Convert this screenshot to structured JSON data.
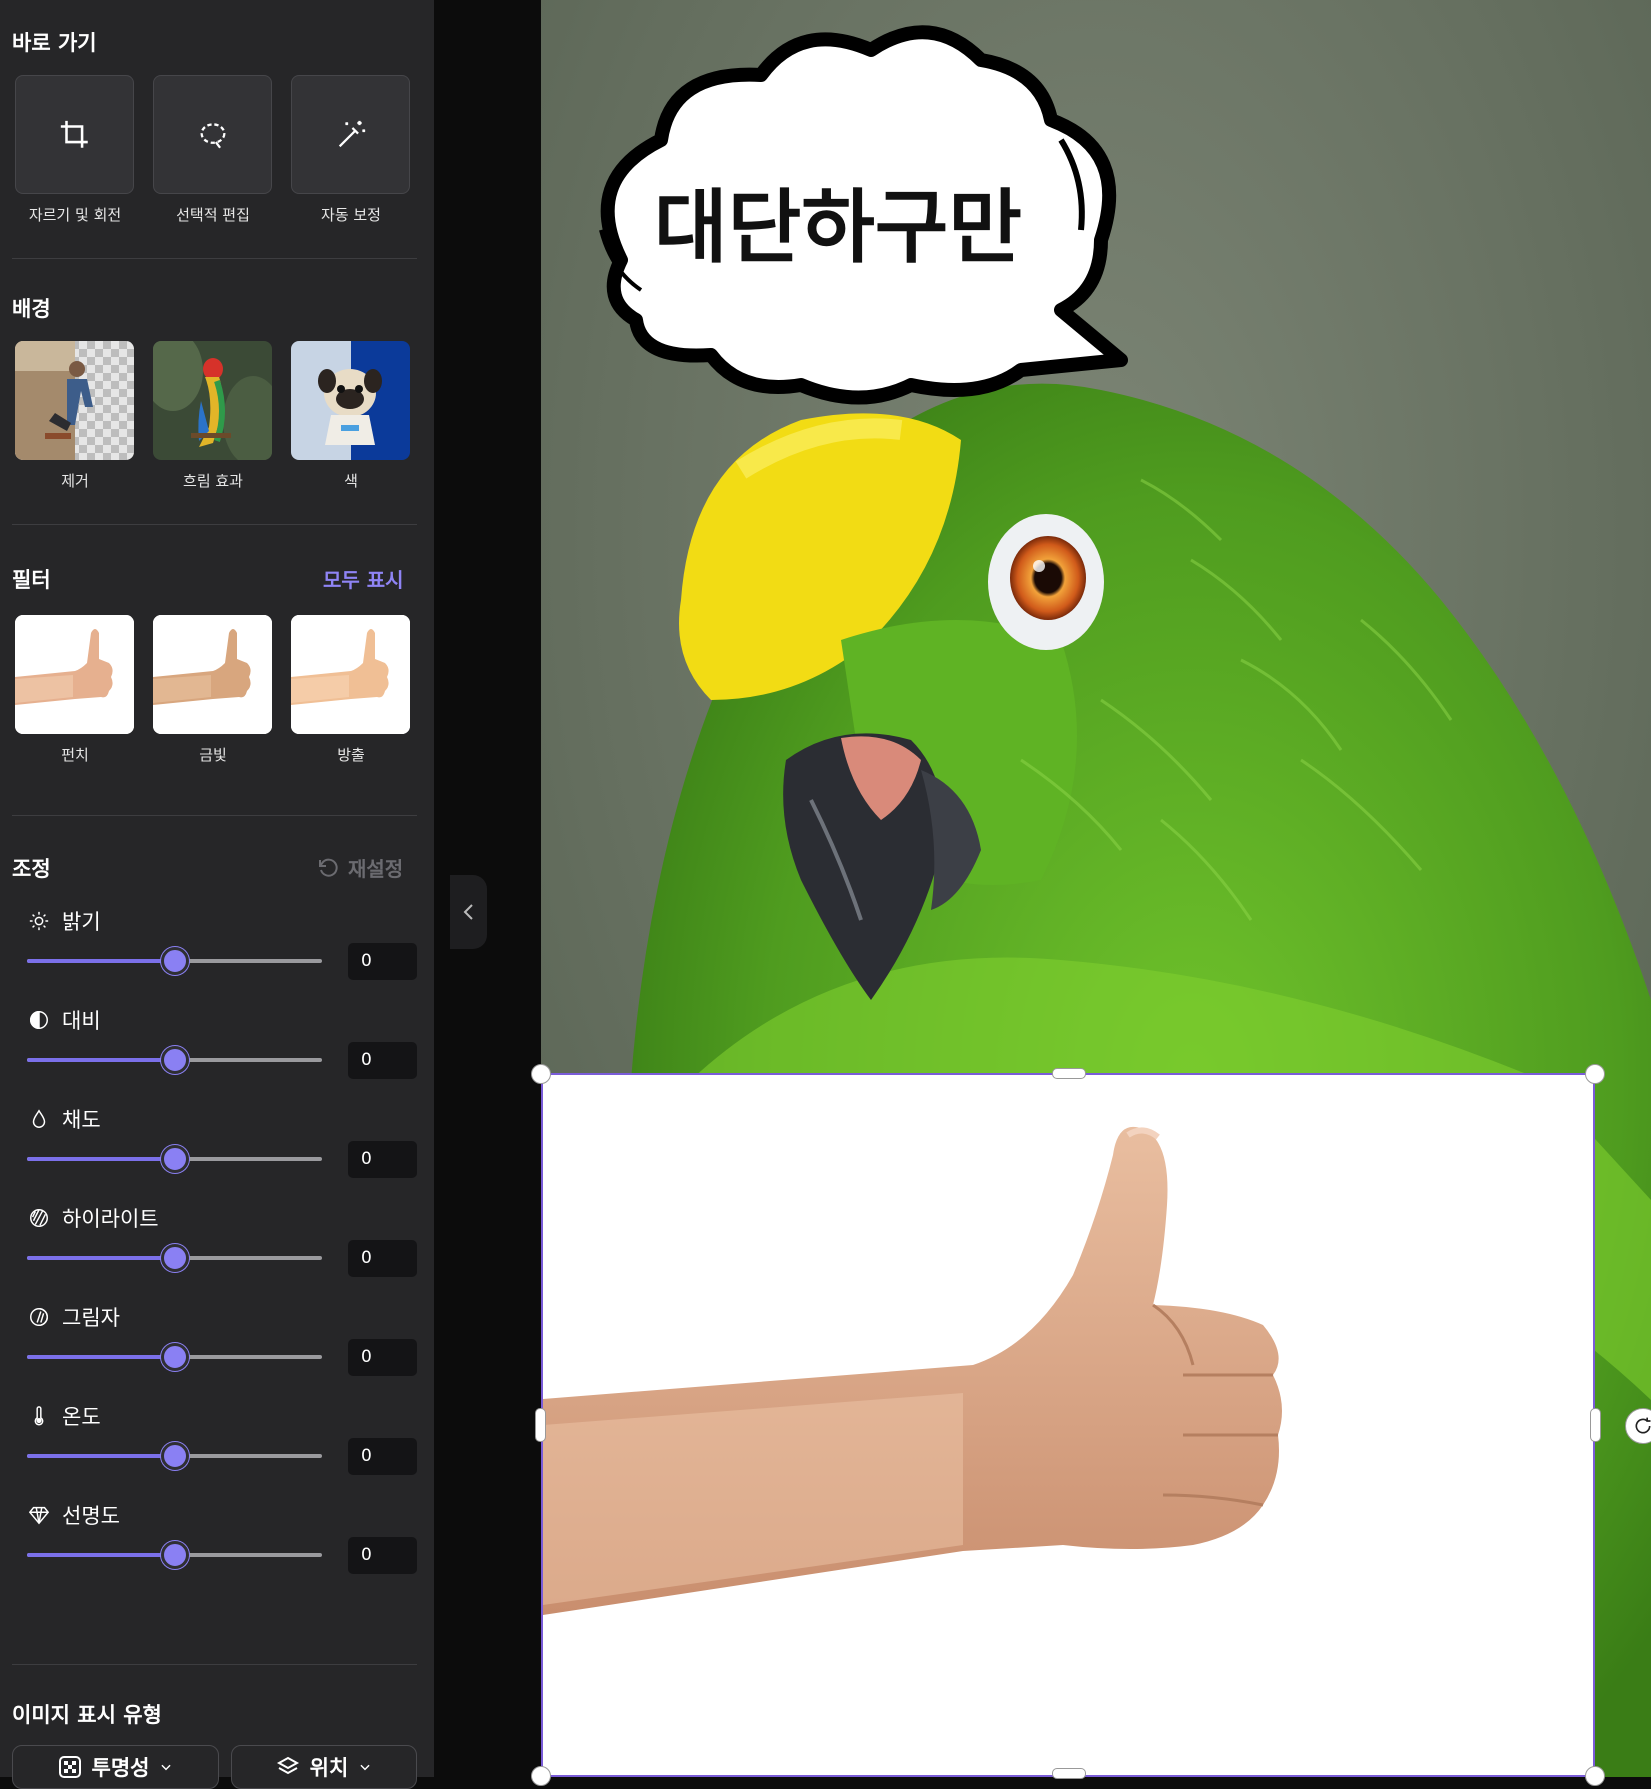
{
  "sidebar": {
    "quick_access": {
      "title": "바로 가기",
      "tools": [
        {
          "label": "자르기 및 회전",
          "icon": "crop-icon"
        },
        {
          "label": "선택적 편집",
          "icon": "lasso-select-icon"
        },
        {
          "label": "자동 보정",
          "icon": "magic-wand-icon"
        }
      ]
    },
    "background": {
      "title": "배경",
      "options": [
        {
          "label": "제거",
          "icon": "remove-background-thumbnail"
        },
        {
          "label": "흐림 효과",
          "icon": "blur-background-thumbnail"
        },
        {
          "label": "색",
          "icon": "color-background-thumbnail"
        }
      ]
    },
    "filters": {
      "title": "필터",
      "show_all": "모두 표시",
      "items": [
        {
          "label": "펀치"
        },
        {
          "label": "금빛"
        },
        {
          "label": "방출"
        }
      ]
    },
    "adjust": {
      "title": "조정",
      "reset": "재설정",
      "sliders": [
        {
          "label": "밝기",
          "value": "0",
          "icon": "brightness-icon",
          "level": 0.5
        },
        {
          "label": "대비",
          "value": "0",
          "icon": "contrast-icon",
          "level": 0.5
        },
        {
          "label": "채도",
          "value": "0",
          "icon": "saturation-drop-icon",
          "level": 0.5
        },
        {
          "label": "하이라이트",
          "value": "0",
          "icon": "highlights-icon",
          "level": 0.5
        },
        {
          "label": "그림자",
          "value": "0",
          "icon": "shadows-icon",
          "level": 0.5
        },
        {
          "label": "온도",
          "value": "0",
          "icon": "thermometer-icon",
          "level": 0.5
        },
        {
          "label": "선명도",
          "value": "0",
          "icon": "diamond-sharpness-icon",
          "level": 0.5
        }
      ]
    },
    "display_type": {
      "title": "이미지 표시 유형",
      "transparency_label": "투명성",
      "position_label": "위치"
    }
  },
  "canvas": {
    "speech_bubble_text": "대단하구만"
  },
  "colors": {
    "accent": "#8a80f3",
    "sidebar_bg": "#262628",
    "selection_border": "#7a5cd8"
  }
}
